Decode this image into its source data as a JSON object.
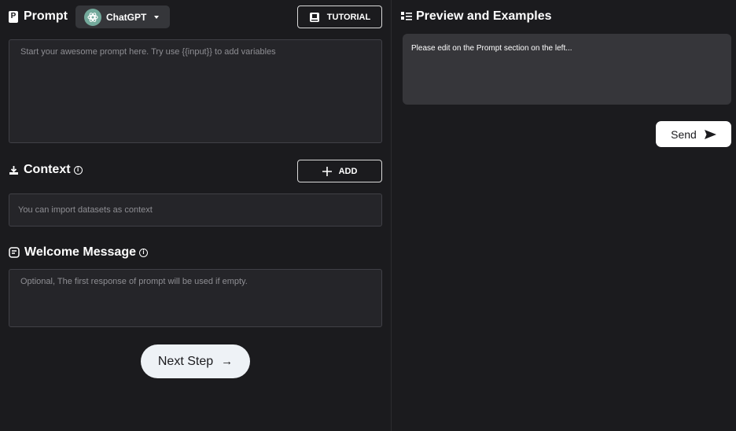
{
  "prompt_section": {
    "title": "Prompt",
    "model": "ChatGPT",
    "tutorial_label": "TUTORIAL",
    "placeholder": "Start your awesome prompt here. Try use {{input}} to add variables"
  },
  "context_section": {
    "title": "Context",
    "add_label": "ADD",
    "placeholder": "You can import datasets as context"
  },
  "welcome_section": {
    "title": "Welcome Message",
    "placeholder": "Optional, The first response of prompt will be used if empty."
  },
  "next_step_label": "Next Step",
  "preview_section": {
    "title": "Preview and Examples",
    "message": "Please edit on the Prompt section on the left...",
    "send_label": "Send"
  },
  "icons": {
    "logo": "p-logo-icon",
    "model": "openai-icon",
    "tutorial": "book-icon",
    "context": "download-icon",
    "welcome": "message-square-icon",
    "info": "info-circle-icon",
    "add": "plus-icon",
    "next": "arrow-right-icon",
    "preview": "list-icon",
    "send": "send-icon"
  },
  "colors": {
    "background": "#1b1b1e",
    "input_bg": "#252529",
    "preview_bg": "#36363a",
    "button_light": "#eef2f6",
    "openai_green": "#74aa9c"
  }
}
